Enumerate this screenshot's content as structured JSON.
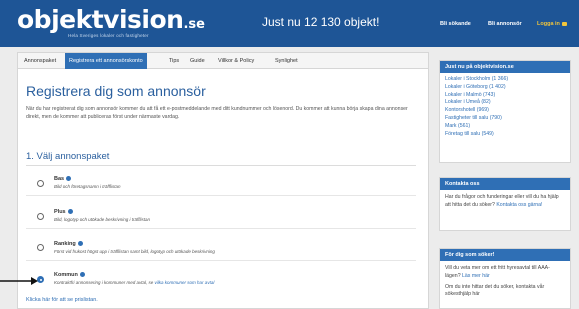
{
  "header": {
    "logo": "objektvision",
    "logo_suffix": ".se",
    "tagline": "Hela Sveriges lokaler och fastigheter",
    "headline": "Just nu 12 130 objekt!",
    "links": [
      "Bli sökande",
      "Bli annonsör",
      "Logga in"
    ]
  },
  "tabs": [
    "Annonspaket",
    "Registrera ett annonsörskonto",
    "Tips",
    "Guide",
    "Villkor & Policy",
    "Synlighet"
  ],
  "active_tab_index": 1,
  "main": {
    "title": "Registrera dig som annonsör",
    "intro": "När du har registrerat dig som annonsör kommer du att få ett e-postmeddelande med ditt kundnummer och lösenord. Du kommer att kunna börja skapa dina annonser direkt, men de kommer att publiceras först under närmaste vardag.",
    "section_title": "1. Välj annonspaket",
    "more_link": "Klicka här för att se prislistan."
  },
  "packages": [
    {
      "name": "Bas",
      "desc": "Bild och företagsnamn i träfflistan",
      "desc_link": "",
      "checked": false
    },
    {
      "name": "Plus",
      "desc": "Bild, logotyp och utökade beskrivning i träfflistan",
      "desc_link": "",
      "checked": false
    },
    {
      "name": "Ranking",
      "desc": "Först vid frukost högst upp i träfflistan samt bild, logotyp och utökade beskrivning",
      "desc_link": "",
      "checked": false
    },
    {
      "name": "Kommun",
      "desc": "Kontraktfri annonsering i kommuner med avtal, se ",
      "desc_link": "vilka kommuner som har avtal",
      "checked": true
    }
  ],
  "sidebar": {
    "latest": {
      "title": "Just nu på objektvision.se",
      "items": [
        "Lokaler i Stockholm (1 366)",
        "Lokaler i Göteborg (1 402)",
        "Lokaler i Malmö (743)",
        "Lokaler i Umeå (82)",
        "Kontorshotell (969)",
        "Fastigheter till salu (790)",
        "Mark (561)",
        "Företag till salu (549)"
      ]
    },
    "contact": {
      "title": "Kontakta oss",
      "text": "Har du frågor och funderingar eller vill du ha hjälp att hitta det du söker?",
      "link": "Kontakta oss gärna!"
    },
    "seekers": {
      "title": "För dig som söker!",
      "text1": "Vill du veta mer om ett fritt hyresavtal till AAA-lägen?",
      "link1": "Läs mer här",
      "text2": "Om du inte hittar det du söker, kontakta vår sökesthjälp här"
    }
  },
  "colors": {
    "brand": "#1e5596",
    "accent": "#2f6fb5",
    "login": "#f2c53b"
  }
}
